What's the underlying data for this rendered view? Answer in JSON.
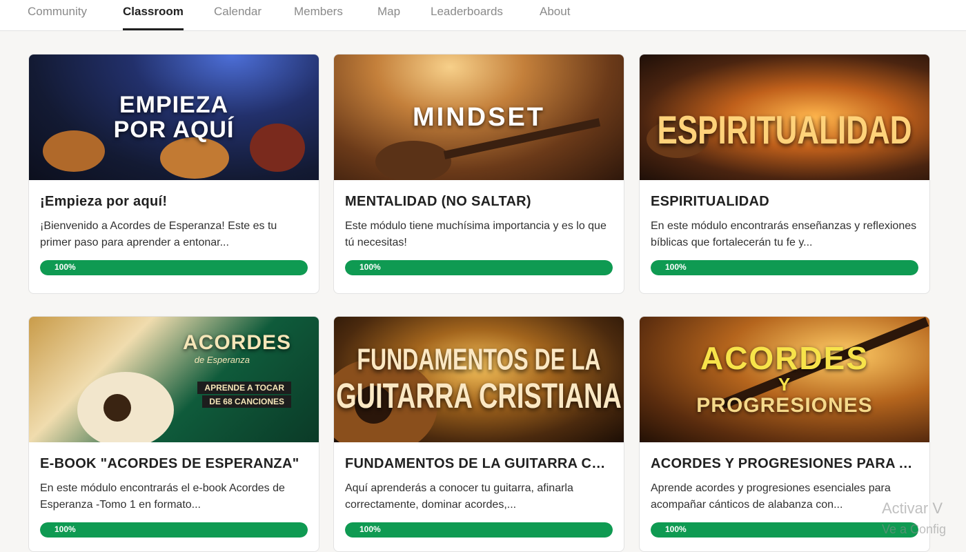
{
  "nav": {
    "tabs": [
      {
        "label": "Community",
        "active": false
      },
      {
        "label": "Classroom",
        "active": true
      },
      {
        "label": "Calendar",
        "active": false
      },
      {
        "label": "Members",
        "active": false
      },
      {
        "label": "Map",
        "active": false
      },
      {
        "label": "Leaderboards",
        "active": false
      },
      {
        "label": "About",
        "active": false
      }
    ]
  },
  "courses": [
    {
      "thumb_text": [
        "EMPIEZA",
        "POR AQUÍ"
      ],
      "title": "¡Empieza por aquí!",
      "description": "¡Bienvenido a Acordes de Esperanza! Este es tu primer paso para aprender a entonar...",
      "progress": 100,
      "progress_label": "100%"
    },
    {
      "thumb_text": [
        "MINDSET"
      ],
      "title": "MENTALIDAD (NO SALTAR)",
      "description": "Este módulo tiene muchísima importancia y es lo que tú necesitas!",
      "progress": 100,
      "progress_label": "100%"
    },
    {
      "thumb_text": [
        "ESPIRITUALIDAD"
      ],
      "title": "ESPIRITUALIDAD",
      "description": "En este módulo encontrarás enseñanzas y reflexiones bíblicas que fortalecerán tu fe y...",
      "progress": 100,
      "progress_label": "100%"
    },
    {
      "thumb_text": [
        "ACORDES",
        "de Esperanza",
        "APRENDE A TOCAR",
        "DE 68 CANCIONES"
      ],
      "title": "E-BOOK \"ACORDES DE ESPERANZA\"",
      "description": "En este módulo encontrarás el e-book Acordes de Esperanza -Tomo 1 en formato...",
      "progress": 100,
      "progress_label": "100%"
    },
    {
      "thumb_text": [
        "FUNDAMENTOS DE LA",
        "GUITARRA CRISTIANA"
      ],
      "title": "FUNDAMENTOS DE LA GUITARRA CRISTIANA",
      "description": "Aquí aprenderás a conocer tu guitarra, afinarla correctamente, dominar acordes,...",
      "progress": 100,
      "progress_label": "100%"
    },
    {
      "thumb_text": [
        "ACORDES",
        "Y",
        "PROGRESIONES"
      ],
      "title": "ACORDES Y PROGRESIONES PARA ALABANZA",
      "description": "Aprende acordes y progresiones esenciales para acompañar cánticos de alabanza con...",
      "progress": 100,
      "progress_label": "100%"
    }
  ],
  "watermark": {
    "line1": "Activar V",
    "line2": "Ve a Config"
  },
  "colors": {
    "accent_green": "#0f9a52",
    "background": "#f7f6f4"
  }
}
